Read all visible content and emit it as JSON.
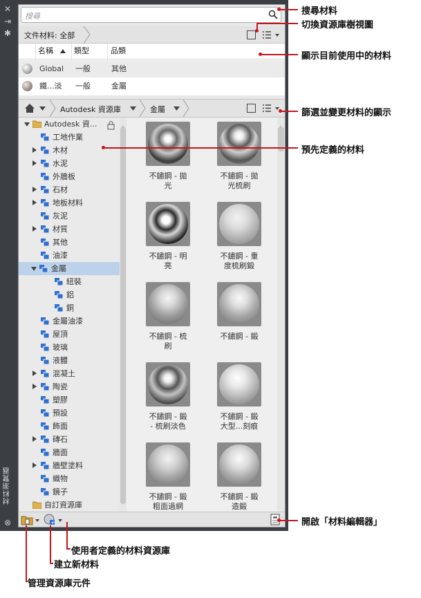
{
  "sidebar": {
    "title": "材料瀏覽器"
  },
  "search": {
    "placeholder": "搜尋"
  },
  "doc_bar": {
    "label": "文件材料: 全部"
  },
  "table": {
    "headers": [
      "名稱",
      "類型",
      "品類"
    ],
    "rows": [
      {
        "name": "Global",
        "type": "一般",
        "category": "其他"
      },
      {
        "name": "鐵...淡",
        "type": "一般",
        "category": "金屬"
      }
    ]
  },
  "library_bar": {
    "library": "Autodesk 資源庫",
    "folder": "金屬"
  },
  "tree": {
    "root": "Autodesk 資...",
    "items": [
      "工地作業",
      "木材",
      "水泥",
      "外牆板",
      "石材",
      "地板材料",
      "灰泥",
      "材質",
      "其他",
      "油漆",
      "金屬",
      "紐裝",
      "鋁",
      "銅",
      "金屬油漆",
      "屋頂",
      "玻璃",
      "液體",
      "混凝土",
      "陶瓷",
      "塑膠",
      "預設",
      "飾面",
      "磚石",
      "牆面",
      "牆壁塗料",
      "織物",
      "鏡子"
    ],
    "custom": "自訂資源庫"
  },
  "materials": [
    {
      "line1": "不鏽鋼 - 拋",
      "line2": "光"
    },
    {
      "line1": "不鏽鋼 - 拋",
      "line2": "光梳刷"
    },
    {
      "line1": "不鏽鋼 - 明",
      "line2": "亮"
    },
    {
      "line1": "不鏽鋼 - 重",
      "line2": "度梳刷鍛"
    },
    {
      "line1": "不鏽鋼 - 梳",
      "line2": "刷"
    },
    {
      "line1": "不鏽鋼 - 鍛",
      "line2": ""
    },
    {
      "line1": "不鏽鋼 - 鍛",
      "line2": "- 梳刷淡色"
    },
    {
      "line1": "不鏽鋼 - 鍛",
      "line2": "大型...刻痕"
    },
    {
      "line1": "不鏽鋼 - 鍛",
      "line2": "粗面過網"
    },
    {
      "line1": "不鏽鋼 - 鍛",
      "line2": "造鍛"
    }
  ],
  "annotations": {
    "search": "搜尋材料",
    "toggle": "切換資源庫樹視圖",
    "current": "顯示目前使用中的材料",
    "filter": "篩選並變更材料的顯示",
    "predefined": "預先定義的材料",
    "editor": "開啟「材料編輯器」",
    "user_lib": "使用者定義的材料資源庫",
    "new_mat": "建立新材料",
    "manage": "管理資源庫元件"
  }
}
